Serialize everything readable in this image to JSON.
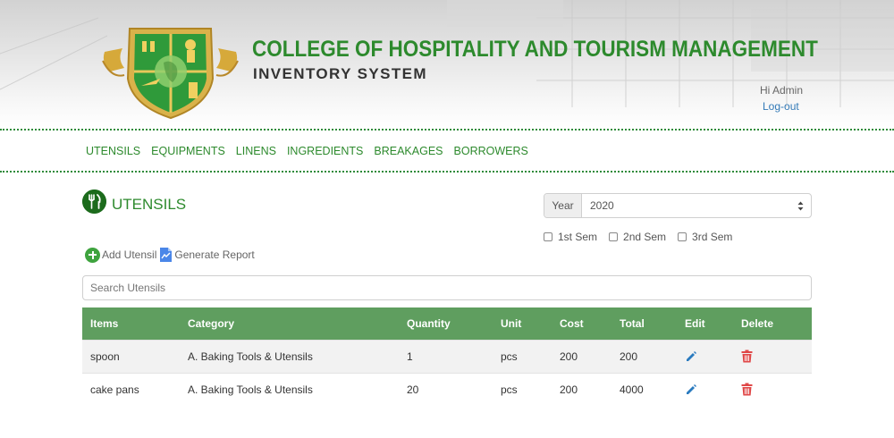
{
  "header": {
    "college_title": "COLLEGE OF HOSPITALITY AND TOURISM MANAGEMENT",
    "system_title": "INVENTORY SYSTEM",
    "greeting": "Hi Admin",
    "logout_label": "Log-out"
  },
  "nav": {
    "items": [
      "UTENSILS",
      "EQUIPMENTS",
      "LINENS",
      "INGREDIENTS",
      "BREAKAGES",
      "BORROWERS"
    ]
  },
  "page": {
    "title": "UTENSILS",
    "icon": "fork-knife-icon"
  },
  "filters": {
    "year_label": "Year",
    "year_value": "2020",
    "semesters": [
      "1st Sem",
      "2nd Sem",
      "3rd Sem"
    ]
  },
  "actions": {
    "add_label": "Add Utensil",
    "report_label": "Generate Report"
  },
  "search": {
    "placeholder": "Search Utensils"
  },
  "table": {
    "headers": [
      "Items",
      "Category",
      "Quantity",
      "Unit",
      "Cost",
      "Total",
      "Edit",
      "Delete"
    ],
    "rows": [
      {
        "item": "spoon",
        "category": "A. Baking Tools & Utensils",
        "quantity": "1",
        "unit": "pcs",
        "cost": "200",
        "total": "200"
      },
      {
        "item": "cake pans",
        "category": "A. Baking Tools & Utensils",
        "quantity": "20",
        "unit": "pcs",
        "cost": "200",
        "total": "4000"
      }
    ]
  },
  "colors": {
    "brand_green": "#2d8a2d",
    "table_header": "#5f9e5f",
    "link_blue": "#337ab7",
    "delete_red": "#e04848",
    "edit_blue": "#2a7bbf"
  }
}
